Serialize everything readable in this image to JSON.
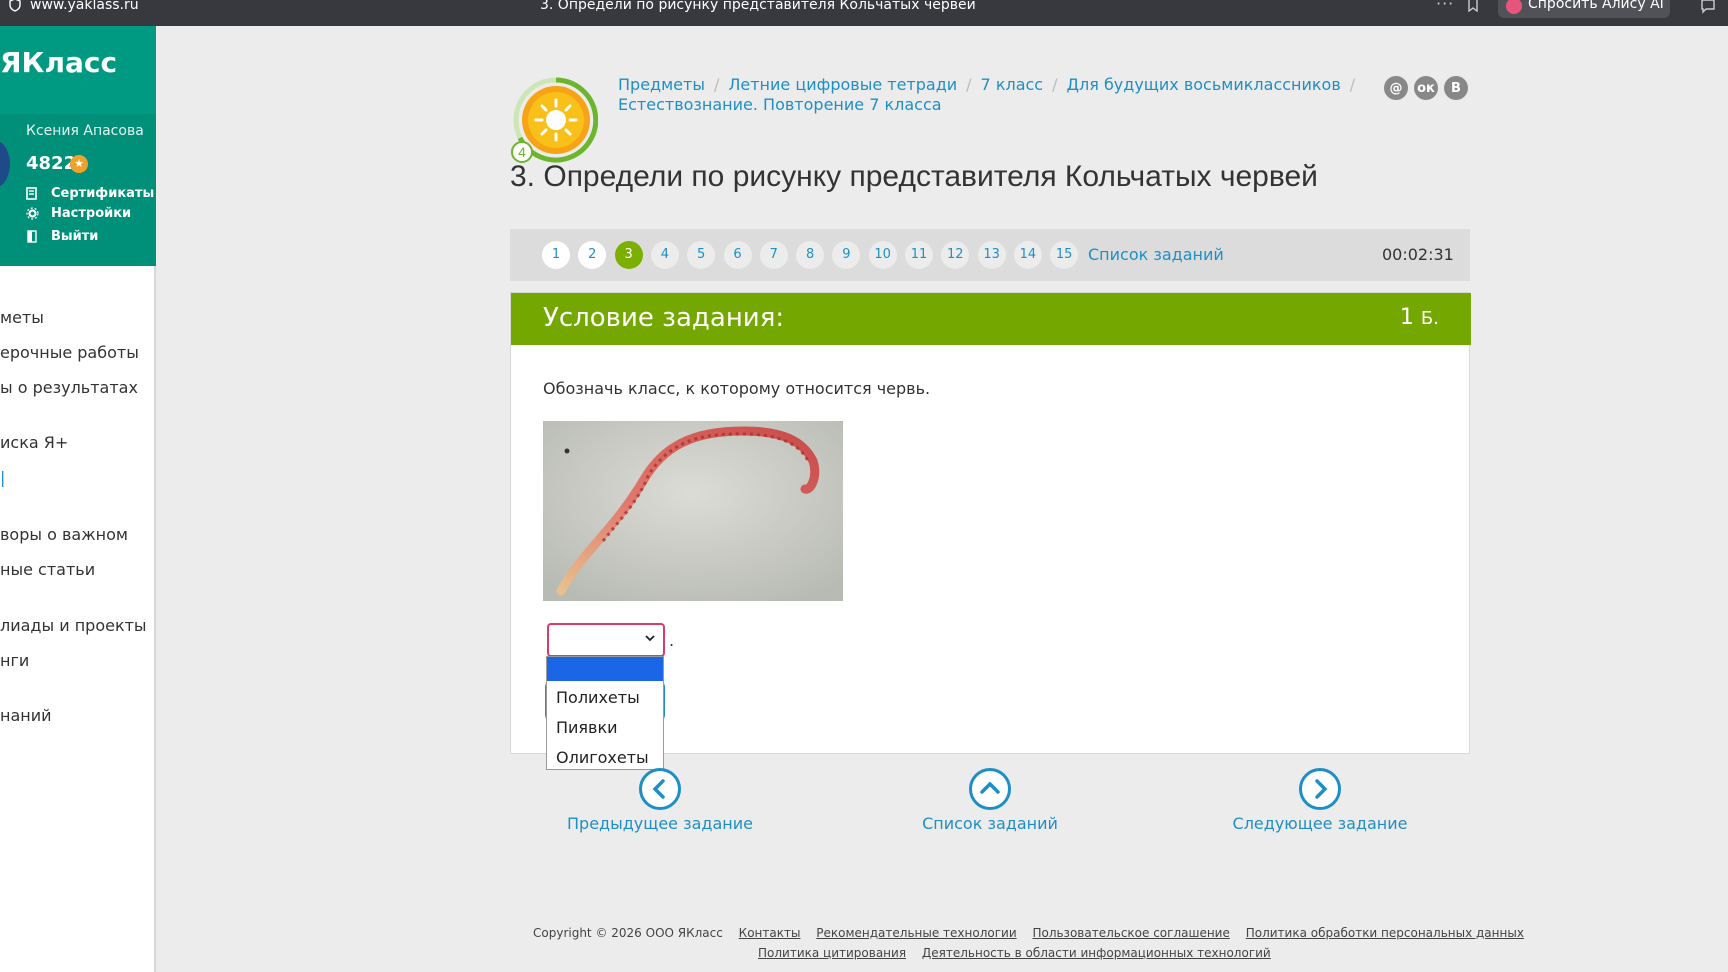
{
  "browser": {
    "url": "www.yaklass.ru",
    "tab_title": "3. Определи по рисунку представителя Кольчатых червей",
    "dots": "···",
    "assistant_label": "Спросить Алису AI"
  },
  "sidebar": {
    "brand": "ЯКласс",
    "user_name": "Ксения Апасова",
    "points": "4822",
    "menu": [
      {
        "label": "Сертификаты"
      },
      {
        "label": "Настройки"
      },
      {
        "label": "Выйти"
      }
    ],
    "links": [
      {
        "label": "меты"
      },
      {
        "label": "ерочные работы"
      },
      {
        "label": "ы о результатах"
      },
      {
        "label": "иска Я+"
      },
      {
        "label": "|"
      },
      {
        "label": "воры о важном"
      },
      {
        "label": "ные статьи"
      },
      {
        "label": "лиады и проекты"
      },
      {
        "label": "нги"
      },
      {
        "label": "наний"
      }
    ]
  },
  "breadcrumb": {
    "items": [
      "Предметы",
      "Летние цифровые тетради",
      "7 класс",
      "Для будущих восьмиклассников",
      "Естествознание. Повторение 7 класса"
    ],
    "level_badge": "4"
  },
  "social": [
    "@",
    "ок",
    "В"
  ],
  "page_title": "3. Определи по рисунку представителя Кольчатых червей",
  "task_nav": {
    "numbers": [
      "1",
      "2",
      "3",
      "4",
      "5",
      "6",
      "7",
      "8",
      "9",
      "10",
      "11",
      "12",
      "13",
      "14",
      "15"
    ],
    "active": 3,
    "done": [
      1,
      2
    ],
    "list_label": "Список заданий",
    "timer": "00:02:31"
  },
  "task": {
    "header": "Условие задания:",
    "score_value": "1",
    "score_unit": "Б.",
    "question": "Обозначь класс, к которому относится червь.",
    "select_after": "."
  },
  "dropdown": {
    "selected_index": 0,
    "options": [
      "",
      "Полихеты",
      "Пиявки",
      "Олигохеты"
    ]
  },
  "bottom_nav": {
    "prev": "Предыдущее задание",
    "list": "Список заданий",
    "next": "Следующее задание"
  },
  "footer": {
    "copyright": "Copyright © 2026 ООО ЯКласс",
    "links_row1": [
      "Контакты",
      "Рекомендательные технологии",
      "Пользовательское соглашение",
      "Политика обработки персональных данных"
    ],
    "links_row2": [
      "Политика цитирования",
      "Деятельность в области информационных технологий"
    ]
  },
  "colors": {
    "brand": "#00907a",
    "accent_green": "#74a800",
    "link_blue": "#1e8fc6",
    "select_border": "#d93b6b",
    "option_highlight": "#1a66e6"
  }
}
